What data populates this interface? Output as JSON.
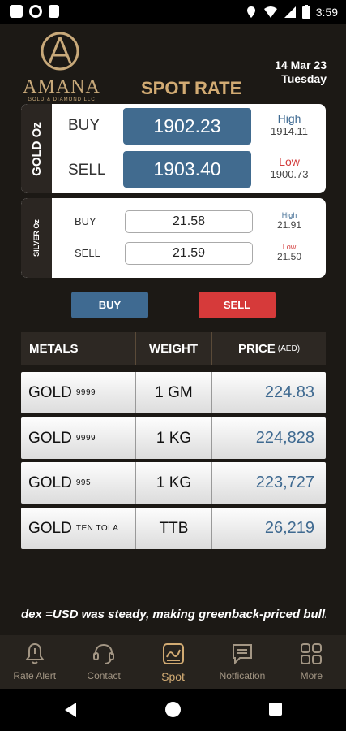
{
  "status_bar": {
    "time": "3:59"
  },
  "brand": {
    "name": "AMANA",
    "tagline": "GOLD & DIAMOND LLC"
  },
  "header": {
    "title": "SPOT RATE",
    "date": "14 Mar 23",
    "day": "Tuesday"
  },
  "gold_spot": {
    "label": "GOLD Oz",
    "buy_label": "BUY",
    "buy_value": "1902.23",
    "sell_label": "SELL",
    "sell_value": "1903.40",
    "high_label": "High",
    "high_value": "1914.11",
    "low_label": "Low",
    "low_value": "1900.73"
  },
  "silver_spot": {
    "label": "SILVER Oz",
    "buy_label": "BUY",
    "buy_value": "21.58",
    "sell_label": "SELL",
    "sell_value": "21.59",
    "high_label": "High",
    "high_value": "21.91",
    "low_label": "Low",
    "low_value": "21.50"
  },
  "actions": {
    "buy": "BUY",
    "sell": "SELL"
  },
  "table": {
    "headers": {
      "metals": "METALS",
      "weight": "WEIGHT",
      "price": "PRICE",
      "price_unit": "(AED)"
    },
    "rows": [
      {
        "metal": "GOLD",
        "purity": "9999",
        "weight": "1 GM",
        "price": "224.83"
      },
      {
        "metal": "GOLD",
        "purity": "9999",
        "weight": "1 KG",
        "price": "224,828"
      },
      {
        "metal": "GOLD",
        "purity": "995",
        "weight": "1 KG",
        "price": "223,727"
      },
      {
        "metal": "GOLD",
        "purity": "TEN TOLA",
        "weight": "TTB",
        "price": "26,219"
      }
    ]
  },
  "ticker": {
    "text": "dex =USD was steady, making greenback-priced bulli"
  },
  "tabs": [
    {
      "label": "Rate Alert",
      "icon": "bell-icon"
    },
    {
      "label": "Contact",
      "icon": "headset-icon"
    },
    {
      "label": "Spot",
      "icon": "chart-icon"
    },
    {
      "label": "Notfication",
      "icon": "message-icon"
    },
    {
      "label": "More",
      "icon": "grid-icon"
    }
  ],
  "colors": {
    "gold_accent": "#d2ab73",
    "buy_blue": "#416b8f",
    "sell_red": "#d63a3a",
    "background": "#1c1915"
  }
}
